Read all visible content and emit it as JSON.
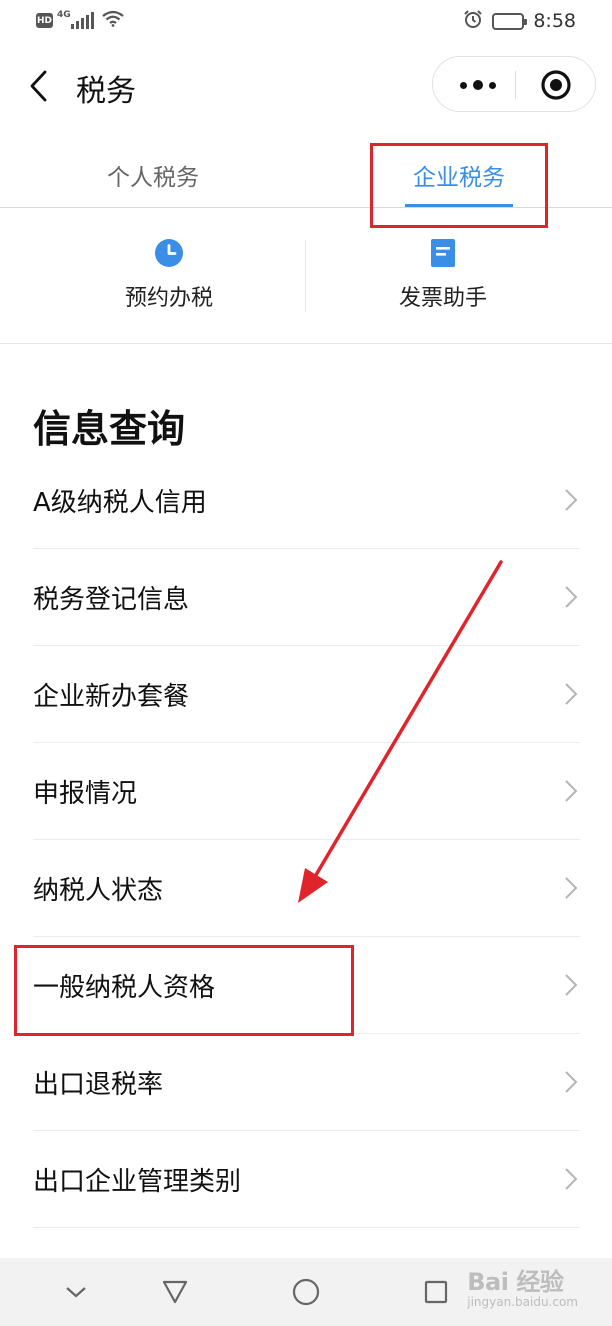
{
  "status_bar": {
    "badge": "HD",
    "network": "4G",
    "time": "8:58"
  },
  "nav": {
    "title": "税务"
  },
  "tabs": [
    {
      "label": "个人税务",
      "active": false
    },
    {
      "label": "企业税务",
      "active": true
    }
  ],
  "quick_services": [
    {
      "label": "预约办税",
      "icon": "clock-icon"
    },
    {
      "label": "发票助手",
      "icon": "document-icon"
    }
  ],
  "info_section": {
    "title": "信息查询",
    "items": [
      {
        "label": "A级纳税人信用"
      },
      {
        "label": "税务登记信息"
      },
      {
        "label": "企业新办套餐"
      },
      {
        "label": "申报情况"
      },
      {
        "label": "纳税人状态"
      },
      {
        "label": "一般纳税人资格"
      },
      {
        "label": "出口退税率"
      },
      {
        "label": "出口企业管理类别"
      }
    ]
  },
  "watermark": {
    "brand": "Bai 经验",
    "url": "jingyan.baidu.com"
  },
  "colors": {
    "accent": "#3a8ee6",
    "annotation": "#e0242b",
    "text": "#111111"
  }
}
